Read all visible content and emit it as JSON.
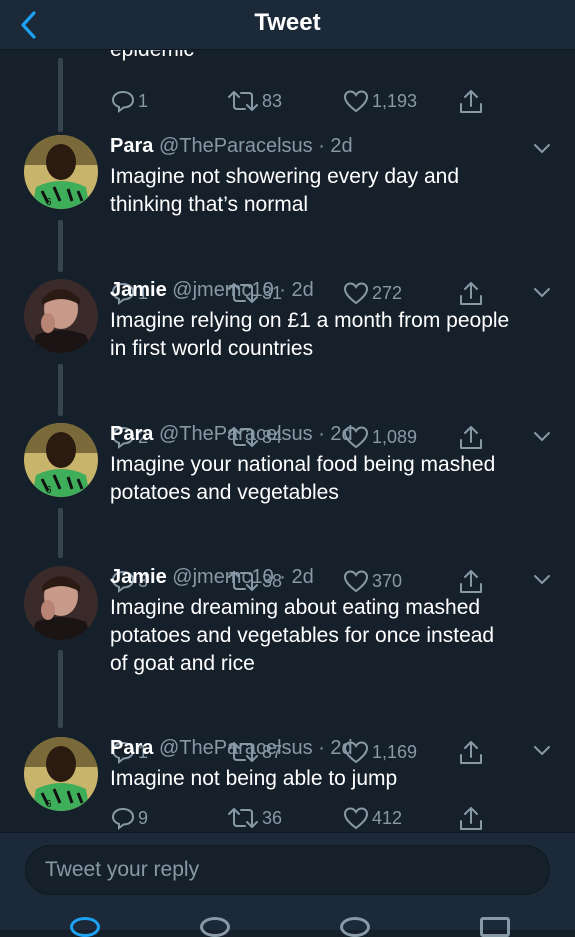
{
  "header": {
    "title": "Tweet",
    "back_icon": "chevron-left-icon",
    "accent": "#1da1f2"
  },
  "partial": {
    "text": "epidemic",
    "replies": "1",
    "retweets": "83",
    "likes": "1,193"
  },
  "tweets": [
    {
      "name": "Para",
      "handle": "@TheParacelsus",
      "time": "· 2d",
      "lines": [
        "Imagine not showering every day and",
        "thinking that’s normal"
      ],
      "replies": "1",
      "retweets": "31",
      "likes": "272"
    },
    {
      "name": "Jamie",
      "handle": "@jmemc10",
      "time": "· 2d",
      "lines": [
        "Imagine relying on £1 a month from people",
        "in first world countries"
      ],
      "replies": "2",
      "retweets": "84",
      "likes": "1,089"
    },
    {
      "name": "Para",
      "handle": "@TheParacelsus",
      "time": "· 2d",
      "lines": [
        "Imagine your national food being mashed",
        "potatoes and vegetables"
      ],
      "replies": "3",
      "retweets": "38",
      "likes": "370"
    },
    {
      "name": "Jamie",
      "handle": "@jmemc10",
      "time": "· 2d",
      "lines": [
        "Imagine dreaming about eating mashed",
        "potatoes and vegetables for once instead",
        "of goat and rice"
      ],
      "replies": "1",
      "retweets": "87",
      "likes": "1,169"
    },
    {
      "name": "Para",
      "handle": "@TheParacelsus",
      "time": "· 2d",
      "lines": [
        "Imagine not being able to jump"
      ],
      "replies": "9",
      "retweets": "36",
      "likes": "412"
    }
  ],
  "reply": {
    "placeholder": "Tweet your reply"
  }
}
